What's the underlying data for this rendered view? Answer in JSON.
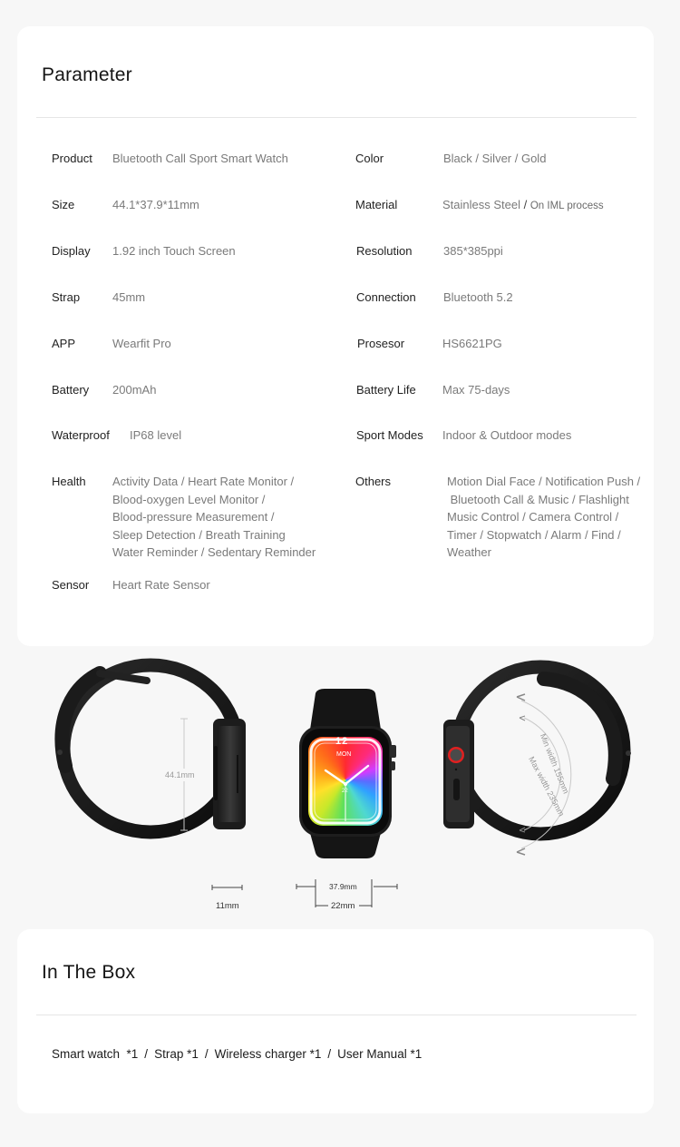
{
  "parameter_section": {
    "title": "Parameter",
    "left_column": [
      {
        "label": "Product",
        "value": "Bluetooth Call Sport Smart Watch"
      },
      {
        "label": "Size",
        "value": "44.1*37.9*11mm"
      },
      {
        "label": "Display",
        "value": "1.92 inch Touch Screen"
      },
      {
        "label": "Strap",
        "value": "45mm"
      },
      {
        "label": "APP",
        "value": "Wearfit Pro"
      },
      {
        "label": "Battery",
        "value": "200mAh"
      },
      {
        "label": "Waterproof",
        "value": "IP68 level"
      },
      {
        "label": "Health",
        "lines": [
          "Activity Data / Heart Rate Monitor /",
          "Blood-oxygen Level Monitor /",
          "Blood-pressure Measurement /",
          "Sleep Detection / Breath Training",
          "Water Reminder / Sedentary Reminder"
        ]
      },
      {
        "label": "Sensor",
        "value": "Heart Rate Sensor"
      }
    ],
    "right_column": [
      {
        "label": "Color",
        "value": "Black / Silver / Gold"
      },
      {
        "label": "Material",
        "value": "Stainless Steel",
        "value_suffix_sep": " / ",
        "value_suffix": "On IML process"
      },
      {
        "label": "Resolution",
        "value": "385*385ppi"
      },
      {
        "label": "Connection",
        "value": "Bluetooth 5.2"
      },
      {
        "label": "Prosesor",
        "value": "HS6621PG"
      },
      {
        "label": "Battery Life",
        "value": "Max 75-days"
      },
      {
        "label": "Sport Modes",
        "value": "Indoor & Outdoor modes"
      },
      {
        "label": "Others",
        "lines": [
          "Motion Dial Face / Notification Push /",
          " Bluetooth Call & Music / Flashlight",
          "Music Control / Camera Control /",
          "Timer / Stopwatch / Alarm / Find /",
          "Weather"
        ]
      }
    ]
  },
  "product_images": {
    "side_view_left": {
      "height_label": "44.1mm",
      "thickness_label": "11mm"
    },
    "front_view": {
      "day_label": "MON",
      "date_label": "22",
      "hour_numeral": "12",
      "width_label": "37.9mm",
      "strap_width_label": "22mm"
    },
    "side_view_right": {
      "max_label": "Max width 235mm",
      "min_label": "Min width 155mm"
    },
    "colors": {
      "strap": "#1a1a1a",
      "case": "#2b2b2b",
      "crown_ring": "#e02020"
    }
  },
  "in_the_box_section": {
    "title": "In The Box",
    "items": [
      "Smart watch  *1",
      "Strap *1",
      "Wireless charger *1",
      "User Manual *1"
    ],
    "separator": "/"
  }
}
